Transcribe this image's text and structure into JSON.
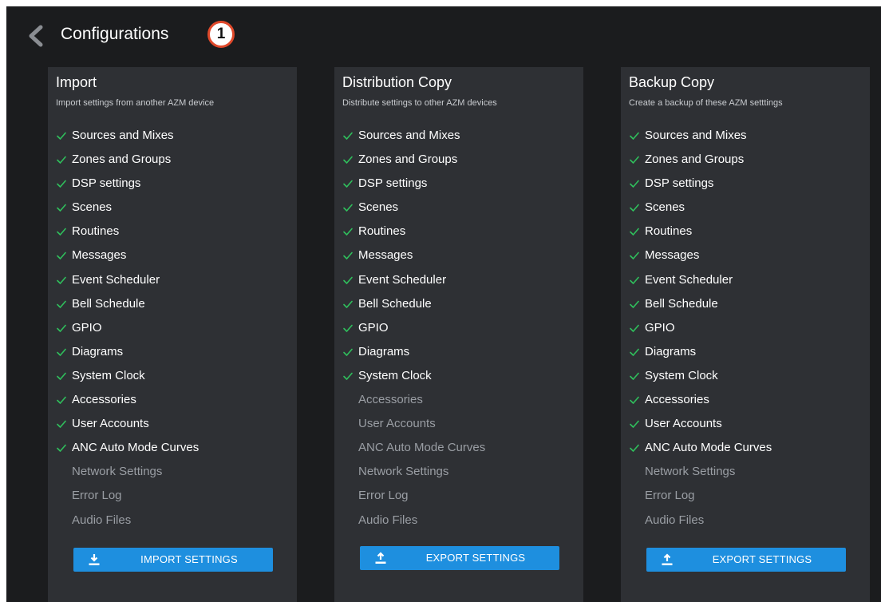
{
  "header": {
    "title": "Configurations",
    "badge": "1"
  },
  "colors": {
    "check": "#2fbf5c",
    "button": "#1e8fdf",
    "panel": "#2e3034",
    "background": "#1b1c1e",
    "badge_border": "#e0492b"
  },
  "panels": [
    {
      "title": "Import",
      "description": "Import settings from another AZM device",
      "items": [
        {
          "label": "Sources and Mixes",
          "checked": true
        },
        {
          "label": "Zones and Groups",
          "checked": true
        },
        {
          "label": "DSP settings",
          "checked": true
        },
        {
          "label": "Scenes",
          "checked": true
        },
        {
          "label": "Routines",
          "checked": true
        },
        {
          "label": "Messages",
          "checked": true
        },
        {
          "label": "Event Scheduler",
          "checked": true
        },
        {
          "label": "Bell Schedule",
          "checked": true
        },
        {
          "label": "GPIO",
          "checked": true
        },
        {
          "label": "Diagrams",
          "checked": true
        },
        {
          "label": "System Clock",
          "checked": true
        },
        {
          "label": "Accessories",
          "checked": true
        },
        {
          "label": "User Accounts",
          "checked": true
        },
        {
          "label": "ANC Auto Mode Curves",
          "checked": true
        },
        {
          "label": "Network Settings",
          "checked": false
        },
        {
          "label": "Error Log",
          "checked": false
        },
        {
          "label": "Audio Files",
          "checked": false
        }
      ],
      "button": {
        "label": "IMPORT SETTINGS",
        "icon": "download-icon"
      }
    },
    {
      "title": "Distribution Copy",
      "description": "Distribute settings to other AZM devices",
      "items": [
        {
          "label": "Sources and Mixes",
          "checked": true
        },
        {
          "label": "Zones and Groups",
          "checked": true
        },
        {
          "label": "DSP settings",
          "checked": true
        },
        {
          "label": "Scenes",
          "checked": true
        },
        {
          "label": "Routines",
          "checked": true
        },
        {
          "label": "Messages",
          "checked": true
        },
        {
          "label": "Event Scheduler",
          "checked": true
        },
        {
          "label": "Bell Schedule",
          "checked": true
        },
        {
          "label": "GPIO",
          "checked": true
        },
        {
          "label": "Diagrams",
          "checked": true
        },
        {
          "label": "System Clock",
          "checked": true
        },
        {
          "label": "Accessories",
          "checked": false
        },
        {
          "label": "User Accounts",
          "checked": false
        },
        {
          "label": "ANC Auto Mode Curves",
          "checked": false
        },
        {
          "label": "Network Settings",
          "checked": false
        },
        {
          "label": "Error Log",
          "checked": false
        },
        {
          "label": "Audio Files",
          "checked": false
        }
      ],
      "button": {
        "label": "EXPORT SETTINGS",
        "icon": "upload-icon"
      }
    },
    {
      "title": "Backup Copy",
      "description": "Create a backup of these AZM setttings",
      "items": [
        {
          "label": "Sources and Mixes",
          "checked": true
        },
        {
          "label": "Zones and Groups",
          "checked": true
        },
        {
          "label": "DSP settings",
          "checked": true
        },
        {
          "label": "Scenes",
          "checked": true
        },
        {
          "label": "Routines",
          "checked": true
        },
        {
          "label": "Messages",
          "checked": true
        },
        {
          "label": "Event Scheduler",
          "checked": true
        },
        {
          "label": "Bell Schedule",
          "checked": true
        },
        {
          "label": "GPIO",
          "checked": true
        },
        {
          "label": "Diagrams",
          "checked": true
        },
        {
          "label": "System Clock",
          "checked": true
        },
        {
          "label": "Accessories",
          "checked": true
        },
        {
          "label": "User Accounts",
          "checked": true
        },
        {
          "label": "ANC Auto Mode Curves",
          "checked": true
        },
        {
          "label": "Network Settings",
          "checked": false
        },
        {
          "label": "Error Log",
          "checked": false
        },
        {
          "label": "Audio Files",
          "checked": false
        }
      ],
      "button": {
        "label": "EXPORT SETTINGS",
        "icon": "upload-icon"
      }
    }
  ]
}
